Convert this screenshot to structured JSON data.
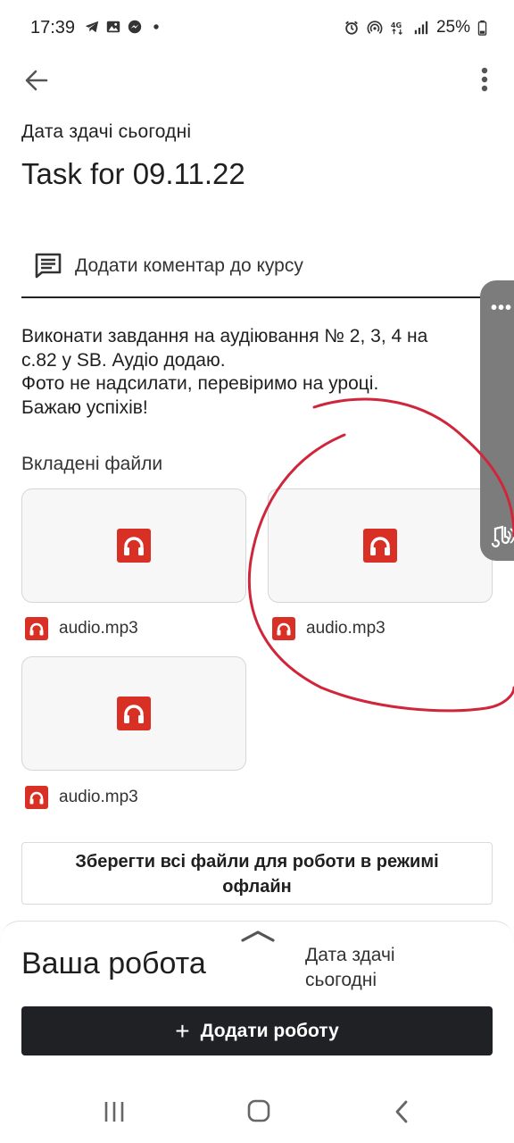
{
  "status_bar": {
    "time": "17:39",
    "battery": "25%",
    "left_icons": [
      "telegram-icon",
      "gallery-icon",
      "messenger-icon",
      "dot-icon"
    ],
    "right_icons": [
      "alarm-icon",
      "hotspot-icon",
      "4g-icon",
      "signal-icon",
      "battery-icon"
    ]
  },
  "header": {
    "due_label": "Дата здачі сьогодні",
    "title": "Task for 09.11.22"
  },
  "comment": {
    "label": "Додати коментар до курсу"
  },
  "description": {
    "lines": [
      "Виконати завдання на аудіювання № 2, 3, 4 на",
      "с.82 у SB. Аудіо додаю.",
      "Фото не надсилати, перевіримо на уроці.",
      "Бажаю успіхів!"
    ]
  },
  "attachments": {
    "heading": "Вкладені файли",
    "files": [
      {
        "name": "audio.mp3",
        "icon": "headphones-icon"
      },
      {
        "name": "audio.mp3",
        "icon": "headphones-icon"
      },
      {
        "name": "audio.mp3",
        "icon": "headphones-icon"
      }
    ]
  },
  "save_offline": {
    "line1": "Зберегти всі файли для роботи в режимі",
    "line2": "офлайн"
  },
  "your_work": {
    "title": "Ваша робота",
    "due_line1": "Дата здачі",
    "due_line2": "сьогодні",
    "add_button": "Додати роботу"
  },
  "colors": {
    "accent_red": "#d93025",
    "button_dark": "#202124",
    "annotation_red": "#d0263b"
  }
}
